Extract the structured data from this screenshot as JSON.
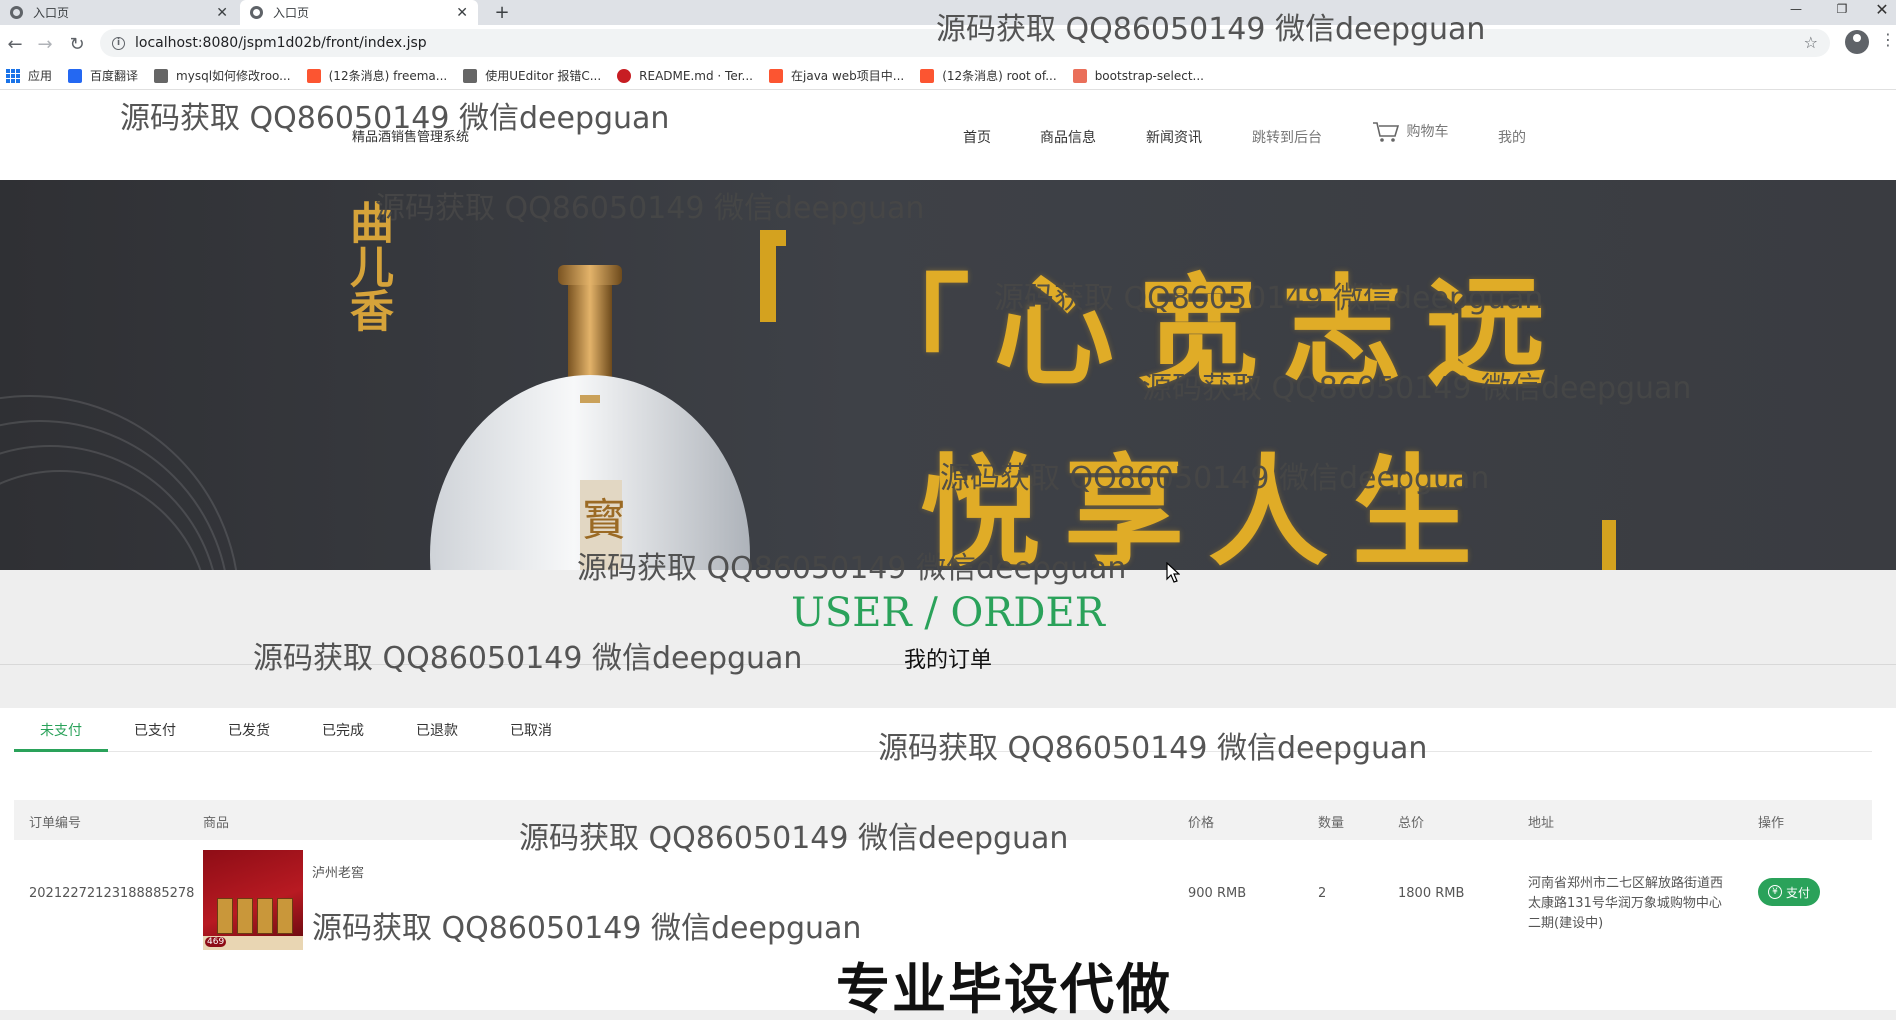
{
  "browser": {
    "tabs": [
      {
        "title": "入口页"
      },
      {
        "title": "入口页"
      }
    ],
    "url": "localhost:8080/jspm1d02b/front/index.jsp",
    "bookmarks": [
      {
        "label": "应用",
        "icon": "apps-grid-icon",
        "color": "#1a73e8"
      },
      {
        "label": "百度翻译",
        "icon": "baidu-translate-icon",
        "color": "#2468f2"
      },
      {
        "label": "mysql如何修改roo...",
        "icon": "bookmark-icon",
        "color": "#555555"
      },
      {
        "label": "(12条消息) freema...",
        "icon": "csdn-icon",
        "color": "#fc5531"
      },
      {
        "label": "使用UEditor 报错C...",
        "icon": "bookmark-icon",
        "color": "#555555"
      },
      {
        "label": "README.md · Ter...",
        "icon": "gitee-icon",
        "color": "#c71d23"
      },
      {
        "label": "在java web项目中...",
        "icon": "csdn-icon",
        "color": "#fc5531"
      },
      {
        "label": "(12条消息) root of...",
        "icon": "csdn-icon",
        "color": "#fc5531"
      },
      {
        "label": "bootstrap-select...",
        "icon": "jianshu-icon",
        "color": "#ea6f5a"
      }
    ]
  },
  "site": {
    "logo_text": "精品酒销售管理系统",
    "nav": [
      "首页",
      "商品信息",
      "新闻资讯",
      "跳转到后台",
      "购物车",
      "我的"
    ]
  },
  "banner": {
    "seal_text": "曲儿香",
    "slogan_line1": "「心宽志远",
    "slogan_line2": "悦享人生"
  },
  "section": {
    "title_en": "USER / ORDER",
    "title_cn": "我的订单"
  },
  "order_tabs": [
    "未支付",
    "已支付",
    "已发货",
    "已完成",
    "已退款",
    "已取消"
  ],
  "order_table": {
    "headers": [
      "订单编号",
      "商品",
      "价格",
      "数量",
      "总价",
      "地址",
      "操作"
    ],
    "rows": [
      {
        "order_id": "20212272123188885278",
        "product": "泸州老窖",
        "price": "900 RMB",
        "quantity": "2",
        "total": "1800 RMB",
        "address": "河南省郑州市二七区解放路街道西太康路131号华润万象城购物中心二期(建设中)",
        "action": "支付",
        "image_tag": "469"
      }
    ]
  },
  "watermark": "源码获取 QQ86050149 微信deepguan",
  "promo": "专业毕设代做",
  "colors": {
    "accent_green": "#2aa25a",
    "banner_gold": "#e0ac27"
  }
}
